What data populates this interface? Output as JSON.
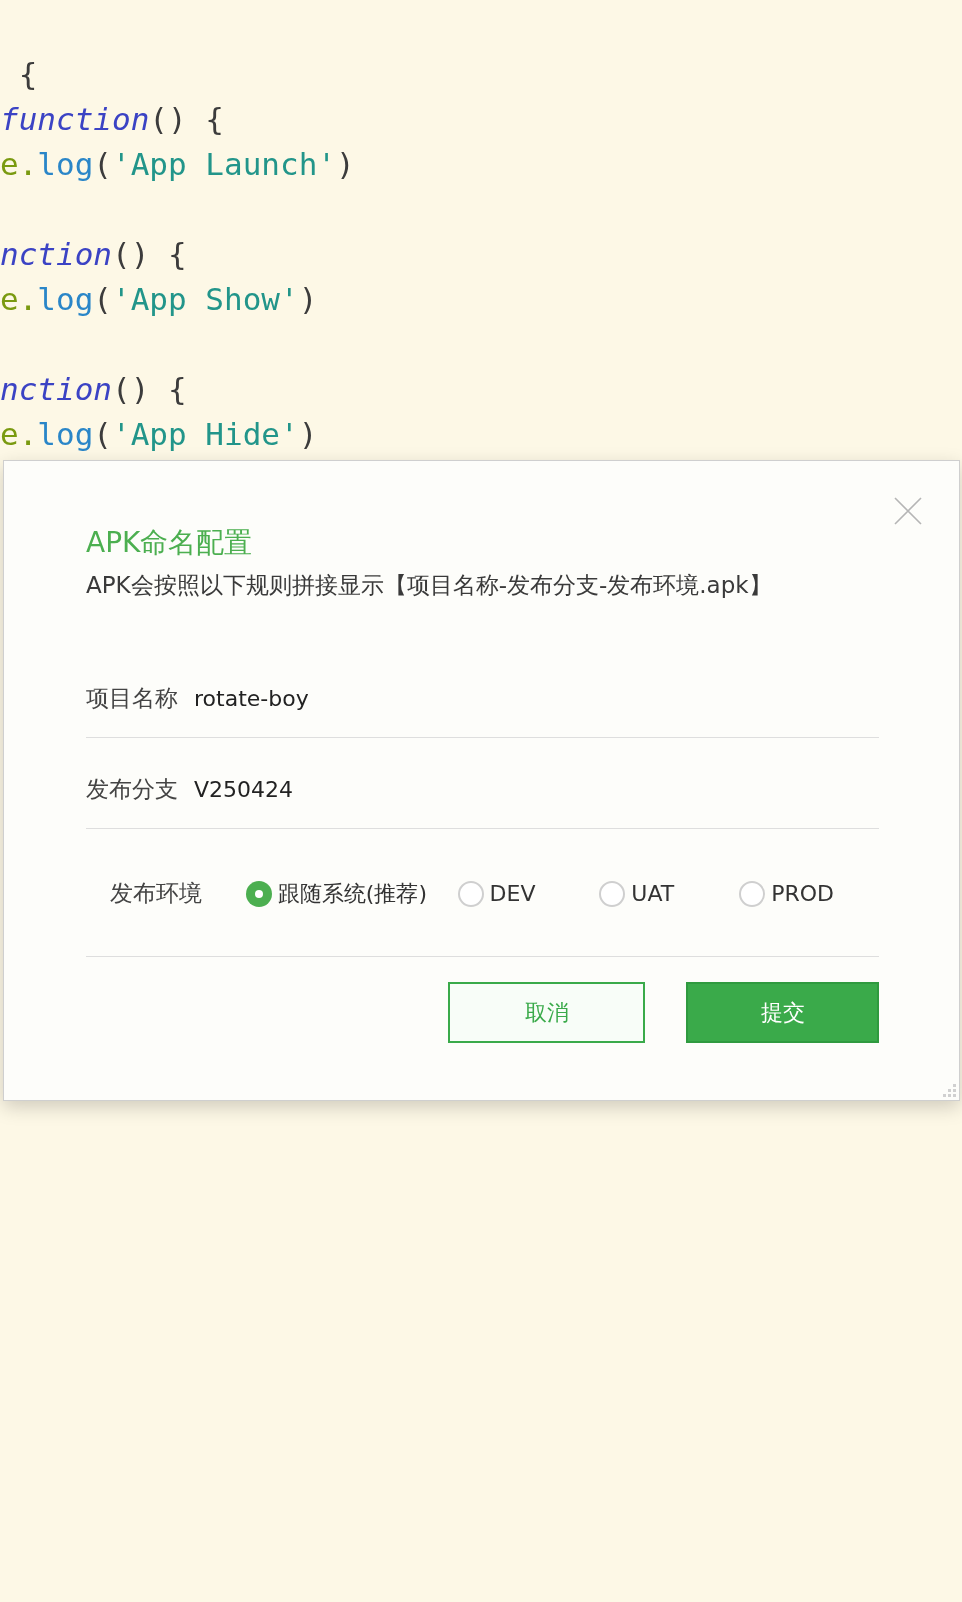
{
  "code_lines": [
    {
      "tokens": [
        {
          "kind": "punct",
          "text": " {"
        }
      ]
    },
    {
      "tokens": [
        {
          "kind": "keyword",
          "text": "function"
        },
        {
          "kind": "punct",
          "text": "() {"
        }
      ]
    },
    {
      "tokens": [
        {
          "kind": "object",
          "text": "e"
        },
        {
          "kind": "dot",
          "text": "."
        },
        {
          "kind": "method",
          "text": "log"
        },
        {
          "kind": "punct",
          "text": "("
        },
        {
          "kind": "string",
          "text": "'App Launch'"
        },
        {
          "kind": "punct",
          "text": ")"
        }
      ]
    },
    {
      "blank_before": true,
      "tokens": [
        {
          "kind": "keyword",
          "text": "nction"
        },
        {
          "kind": "punct",
          "text": "() {"
        }
      ]
    },
    {
      "tokens": [
        {
          "kind": "object",
          "text": "e"
        },
        {
          "kind": "dot",
          "text": "."
        },
        {
          "kind": "method",
          "text": "log"
        },
        {
          "kind": "punct",
          "text": "("
        },
        {
          "kind": "string",
          "text": "'App Show'"
        },
        {
          "kind": "punct",
          "text": ")"
        }
      ]
    },
    {
      "blank_before": true,
      "tokens": [
        {
          "kind": "keyword",
          "text": "nction"
        },
        {
          "kind": "punct",
          "text": "() {"
        }
      ]
    },
    {
      "tokens": [
        {
          "kind": "object",
          "text": "e"
        },
        {
          "kind": "dot",
          "text": "."
        },
        {
          "kind": "method",
          "text": "log"
        },
        {
          "kind": "punct",
          "text": "("
        },
        {
          "kind": "string",
          "text": "'App Hide'"
        },
        {
          "kind": "punct",
          "text": ")"
        }
      ]
    }
  ],
  "dialog": {
    "title": "APK命名配置",
    "description": "APK会按照以下规则拼接显示【项目名称-发布分支-发布环境.apk】",
    "fields": [
      {
        "label": "项目名称",
        "value": "rotate-boy"
      },
      {
        "label": "发布分支",
        "value": "V250424"
      }
    ],
    "environment": {
      "label": "发布环境",
      "options": [
        {
          "label": "跟随系统(推荐)",
          "selected": true
        },
        {
          "label": "DEV",
          "selected": false
        },
        {
          "label": "UAT",
          "selected": false
        },
        {
          "label": "PROD",
          "selected": false
        }
      ]
    },
    "buttons": [
      {
        "kind": "secondary",
        "label": "取消"
      },
      {
        "kind": "primary",
        "label": "提交"
      }
    ]
  }
}
